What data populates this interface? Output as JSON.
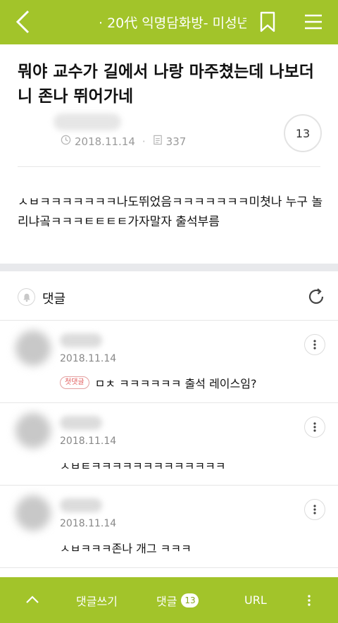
{
  "header": {
    "title": "· 20代 익명담화방- 미성년...",
    "icons": [
      "back-arrow-icon",
      "bookmark-icon",
      "hamburger-menu-icon"
    ]
  },
  "post": {
    "title": "뭐야 교수가 길에서 나랑 마주쳤는데 나보더니 존나 뛰어가네",
    "date": "2018.11.14",
    "views": "337",
    "comment_count": "13",
    "body": "ㅅㅂㅋㅋㅋㅋㅋㅋㅋ나도뛰었음ㅋㅋㅋㅋㅋㅋㅋ미쳣나 누구 놀리냐곸ㅋㅋㅋㅌㅌㅌㅌ가자말자 출석부름"
  },
  "comments_section": {
    "label": "댓글"
  },
  "comments": [
    {
      "date": "2018.11.14",
      "badge": "첫댓글",
      "text": "ㅁㅊ ㅋㅋㅋㅋㅋㅋ 출석 레이스임?"
    },
    {
      "date": "2018.11.14",
      "badge": "",
      "text": "ㅅㅂㅌㅋㅋㅋㅋㅋㅋㅋㅋㅋㅋㅋㅋㅋ"
    },
    {
      "date": "2018.11.14",
      "badge": "",
      "text": "ㅅㅂㅋㅋㅋ존나 개그 ㅋㅋㅋ"
    }
  ],
  "bottom_bar": {
    "write_label": "댓글쓰기",
    "comments_label": "댓글",
    "comments_count": "13",
    "url_label": "URL"
  },
  "colors": {
    "accent": "#a2c42a",
    "divider": "#e6e6e6",
    "section_gap": "#e8e9ec"
  }
}
